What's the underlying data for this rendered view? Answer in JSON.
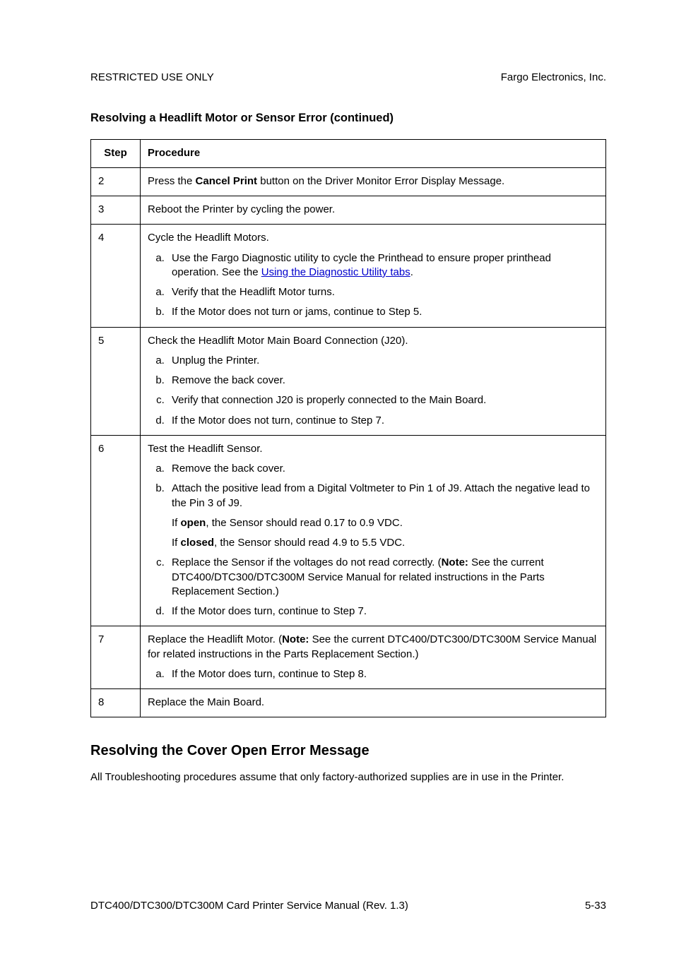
{
  "header": {
    "left": "RESTRICTED USE ONLY",
    "right": "Fargo Electronics, Inc."
  },
  "section_title": "Resolving a Headlift Motor or Sensor Error (continued)",
  "table": {
    "head_step": "Step",
    "head_proc": "Procedure",
    "row2": {
      "step": "2",
      "text_a": "Press the ",
      "bold": "Cancel Print",
      "text_b": " button on the Driver Monitor Error Display Message."
    },
    "row3": {
      "step": "3",
      "text": "Reboot the Printer by cycling the power."
    },
    "row4": {
      "step": "4",
      "intro": "Cycle the Headlift Motors.",
      "a_pre": "Use the Fargo Diagnostic utility to cycle the Printhead to ensure proper printhead operation. See the ",
      "a_link": "Using the Diagnostic Utility tabs",
      "a_post": ".",
      "b": "Verify that the Headlift Motor turns.",
      "c": "If the Motor does not turn or jams, continue to Step 5."
    },
    "row5": {
      "step": "5",
      "intro": "Check the Headlift Motor Main Board Connection (J20).",
      "a": "Unplug the Printer.",
      "b": "Remove the back cover.",
      "c": "Verify that connection J20 is properly connected to the Main Board.",
      "d": "If the Motor does not turn, continue to Step 7."
    },
    "row6": {
      "step": "6",
      "intro": "Test the Headlift Sensor.",
      "a": "Remove the back cover.",
      "b": "Attach the positive lead from a Digital Voltmeter to Pin 1 of J9. Attach the negative lead to the Pin 3 of J9.",
      "nested1_pre": "If ",
      "nested1_bold": "open",
      "nested1_post": ", the Sensor should read 0.17 to 0.9 VDC.",
      "nested2_pre": "If ",
      "nested2_bold": "closed",
      "nested2_post": ", the Sensor should read 4.9 to 5.5 VDC.",
      "c_pre": "Replace the Sensor if the voltages do not read correctly. (",
      "c_bold": "Note:",
      "c_post": "  See the current DTC400/DTC300/DTC300M Service Manual for related instructions in the Parts Replacement Section.)",
      "d": "If the Motor does turn, continue to Step 7."
    },
    "row7": {
      "step": "7",
      "intro_pre": "Replace the Headlift Motor. (",
      "intro_bold": "Note:",
      "intro_post": "  See the current DTC400/DTC300/DTC300M Service Manual for related instructions in the Parts Replacement Section.)",
      "a": "If the Motor does turn, continue to Step 8."
    },
    "row8": {
      "step": "8",
      "text": "Replace the Main Board."
    }
  },
  "h2": "Resolving the Cover Open Error Message",
  "body_para": "All Troubleshooting procedures assume that only factory-authorized supplies are in use in the Printer.",
  "footer": {
    "left": "DTC400/DTC300/DTC300M Card Printer Service Manual (Rev. 1.3)",
    "right": "5-33"
  }
}
